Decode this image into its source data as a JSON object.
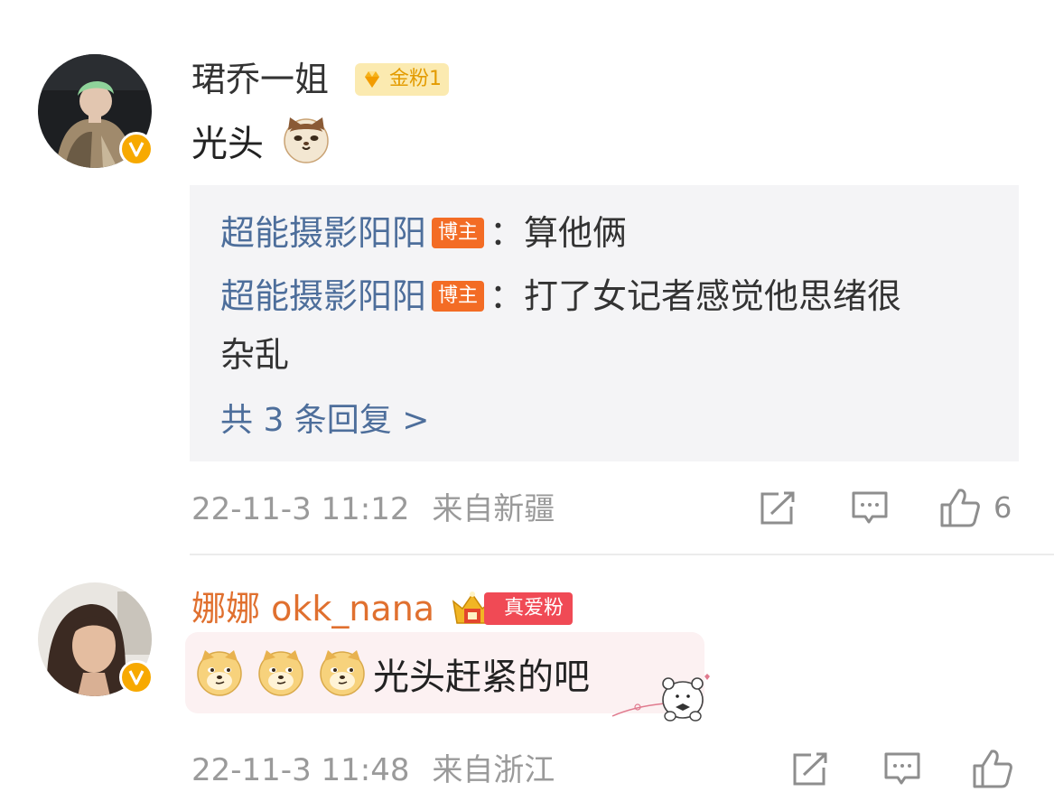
{
  "comments": [
    {
      "username": "珺乔一姐",
      "badge": "金粉1",
      "text": "光头",
      "replies": [
        {
          "name": "超能摄影阳阳",
          "tag": "博主",
          "sep": "：",
          "text": "算他俩"
        },
        {
          "name": "超能摄影阳阳",
          "tag": "博主",
          "sep": "：",
          "text_line1": "打了女记者感觉他思绪很",
          "text_line2": "杂乱"
        }
      ],
      "replies_more": "共 3 条回复 >",
      "time": "22-11-3 11:12",
      "location": "来自新疆",
      "like_count": "6"
    },
    {
      "username": "娜娜 okk_nana",
      "badge": "真爱粉",
      "text": "光头赶紧的吧",
      "time": "22-11-3 11:48",
      "location": "来自浙江",
      "like_count": ""
    }
  ],
  "colors": {
    "username_default": "#333333",
    "username_vip": "#e0702f",
    "reply_link": "#4d6e9b",
    "meta": "#9a9a9a",
    "blogger_tag": "#f36c25",
    "true_fan_tag": "#f04a55",
    "verified": "#f7a900"
  },
  "icons": [
    "verified-icon",
    "gold-gem-icon",
    "cat-emoji",
    "doge-emoji",
    "share-icon",
    "comment-icon",
    "like-icon",
    "crown-icon",
    "bear-sticker"
  ]
}
